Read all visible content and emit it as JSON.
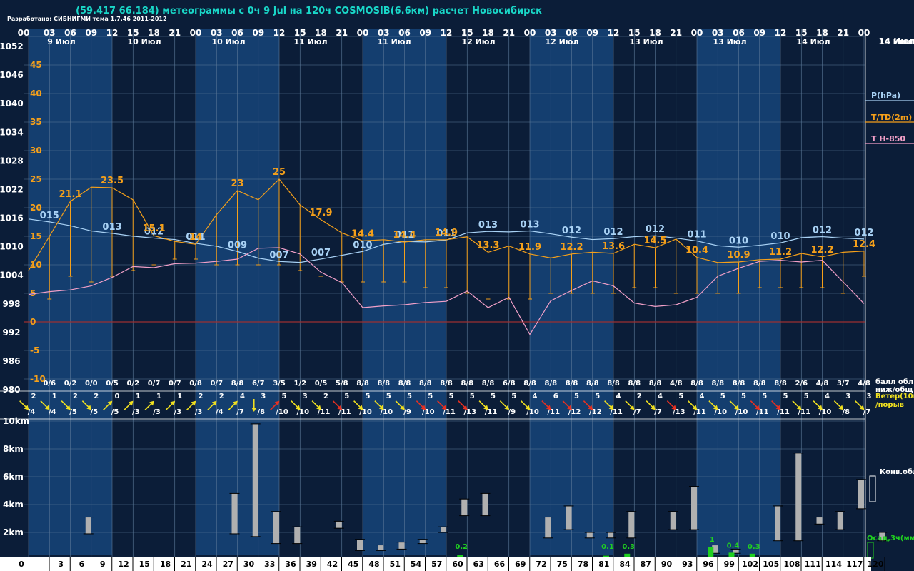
{
  "header": {
    "title": "(59.417 66.184) метеограммы с  0ч 9 Jul на 120ч COSMOSIB(6.6км) расчет Новосибирск",
    "developer": "Разработано: СИБНИГМИ тема 1.7.46 2011-2012"
  },
  "colors": {
    "background": "#0b1d38",
    "band_dark": "#0b1d38",
    "band_light": "#143e6f",
    "grid": "#5d7a99",
    "pressure": "#a9d2f5",
    "temperature": "#f5a01a",
    "t850": "#f2a0c8",
    "wind_normal": "#f0e020",
    "wind_strong": "#e83020",
    "cloud_bars": "#b0b0b0",
    "precip": "#20d020",
    "zero_line": "#9c3030",
    "text": "#ffffff"
  },
  "chart_data": {
    "type": "line",
    "top_hour_ticks": [
      "00",
      "03",
      "06",
      "09",
      "12",
      "15",
      "18",
      "21",
      "00",
      "03",
      "06",
      "09",
      "12",
      "15",
      "18",
      "21",
      "00",
      "03",
      "06",
      "09",
      "12",
      "15",
      "18",
      "21",
      "00",
      "03",
      "06",
      "09",
      "12",
      "15",
      "18",
      "21",
      "00",
      "03",
      "06",
      "09",
      "12",
      "15",
      "18",
      "21",
      "00"
    ],
    "date_labels": [
      "9 Июл",
      "10 Июл",
      "10 Июл",
      "11 Июл",
      "11 Июл",
      "12 Июл",
      "12 Июл",
      "13 Июл",
      "13 Июл",
      "14 Июл",
      "14 Июл"
    ],
    "lead_hours": [
      0,
      3,
      6,
      9,
      12,
      15,
      18,
      21,
      24,
      27,
      30,
      33,
      36,
      39,
      42,
      45,
      48,
      51,
      54,
      57,
      60,
      63,
      66,
      69,
      72,
      75,
      78,
      81,
      84,
      87,
      90,
      93,
      96,
      99,
      102,
      105,
      108,
      111,
      114,
      117,
      120
    ],
    "bottom_hour_labels": [
      "0",
      "3",
      "6",
      "9",
      "12",
      "15",
      "18",
      "21",
      "24",
      "27",
      "30",
      "33",
      "36",
      "39",
      "42",
      "45",
      "48",
      "51",
      "54",
      "57",
      "60",
      "63",
      "66",
      "69",
      "72",
      "75",
      "78",
      "81",
      "84",
      "87",
      "90",
      "93",
      "96",
      "99",
      "102",
      "105",
      "108",
      "111",
      "114",
      "117",
      "120"
    ],
    "pressure_axis_labels": [
      "1052",
      "1046",
      "1040",
      "1034",
      "1028",
      "1022",
      "1016",
      "1010",
      "1004",
      "998",
      "992",
      "986",
      "980"
    ],
    "pressure_ylim": [
      980,
      1052
    ],
    "temperature_axis_labels": [
      "45",
      "40",
      "35",
      "30",
      "25",
      "20",
      "15",
      "10",
      "5",
      "0",
      "-5",
      "-10"
    ],
    "temperature_ylim": [
      -10,
      50
    ],
    "series": [
      {
        "name": "P(hPa)",
        "values": [
          1015.8,
          1015.2,
          1014.4,
          1013.3,
          1012.8,
          1012.2,
          1011.8,
          1011.5,
          1010.7,
          1010.1,
          1009.0,
          1007.6,
          1006.9,
          1006.7,
          1007.4,
          1008.2,
          1009.0,
          1010.5,
          1011.1,
          1011.0,
          1011.4,
          1012.9,
          1013.2,
          1013.1,
          1013.3,
          1012.7,
          1012.0,
          1011.5,
          1011.7,
          1012.1,
          1012.3,
          1011.8,
          1011.2,
          1010.2,
          1009.9,
          1010.3,
          1010.8,
          1011.9,
          1012.1,
          1011.8,
          1011.6
        ],
        "labels": [
          {
            "i": 1,
            "t": "015"
          },
          {
            "i": 4,
            "t": "013"
          },
          {
            "i": 6,
            "t": "012"
          },
          {
            "i": 8,
            "t": "011"
          },
          {
            "i": 10,
            "t": "009"
          },
          {
            "i": 12,
            "t": "007"
          },
          {
            "i": 14,
            "t": "007"
          },
          {
            "i": 16,
            "t": "010"
          },
          {
            "i": 18,
            "t": "011"
          },
          {
            "i": 20,
            "t": "011"
          },
          {
            "i": 22,
            "t": "013"
          },
          {
            "i": 24,
            "t": "013"
          },
          {
            "i": 26,
            "t": "012"
          },
          {
            "i": 28,
            "t": "012"
          },
          {
            "i": 30,
            "t": "012"
          },
          {
            "i": 32,
            "t": "011"
          },
          {
            "i": 34,
            "t": "010"
          },
          {
            "i": 36,
            "t": "010"
          },
          {
            "i": 38,
            "t": "012"
          },
          {
            "i": 40,
            "t": "012"
          }
        ]
      },
      {
        "name": "T/TD(2m)",
        "values": [
          9.0,
          15.0,
          21.1,
          23.6,
          23.5,
          21.4,
          15.1,
          14.1,
          13.6,
          18.8,
          23.0,
          21.4,
          25.0,
          20.5,
          17.9,
          15.6,
          14.2,
          14.4,
          14.0,
          14.4,
          14.4,
          14.9,
          12.2,
          13.3,
          11.9,
          11.2,
          11.9,
          12.2,
          12.0,
          13.6,
          13.0,
          14.5,
          11.3,
          10.4,
          10.5,
          10.9,
          11.0,
          12.0,
          11.4,
          12.2,
          12.4
        ],
        "dewpoint": [
          -2,
          4,
          8,
          7,
          8,
          9,
          10,
          11,
          11,
          10,
          10,
          10,
          10,
          9,
          8,
          7,
          7,
          7,
          7,
          6,
          6,
          5,
          4,
          4,
          4,
          5,
          5,
          5,
          5,
          6,
          6,
          5,
          5,
          5,
          5,
          6,
          6,
          6,
          6,
          5,
          8
        ],
        "labels": [
          {
            "i": 2,
            "t": "21.1"
          },
          {
            "i": 4,
            "t": "23.5"
          },
          {
            "i": 6,
            "t": "15.1"
          },
          {
            "i": 8,
            "t": "14"
          },
          {
            "i": 10,
            "t": "23"
          },
          {
            "i": 12,
            "t": "25"
          },
          {
            "i": 14,
            "t": "17.9"
          },
          {
            "i": 16,
            "t": "14.4"
          },
          {
            "i": 18,
            "t": "14.4"
          },
          {
            "i": 20,
            "t": "14.9"
          },
          {
            "i": 22,
            "t": "13.3"
          },
          {
            "i": 24,
            "t": "11.9"
          },
          {
            "i": 26,
            "t": "12.2"
          },
          {
            "i": 28,
            "t": "13.6"
          },
          {
            "i": 30,
            "t": "14.5"
          },
          {
            "i": 32,
            "t": "10.4"
          },
          {
            "i": 34,
            "t": "10.9"
          },
          {
            "i": 36,
            "t": "11.2"
          },
          {
            "i": 38,
            "t": "12.2"
          },
          {
            "i": 40,
            "t": "12.4"
          }
        ]
      },
      {
        "name": "T H-850",
        "values": [
          4.8,
          5.3,
          5.6,
          6.3,
          7.8,
          9.7,
          9.5,
          10.2,
          10.3,
          10.6,
          11.0,
          12.9,
          13.0,
          11.9,
          8.7,
          6.9,
          2.5,
          2.8,
          3.0,
          3.4,
          3.6,
          5.4,
          2.5,
          4.3,
          -2.2,
          3.7,
          5.5,
          7.2,
          6.3,
          3.3,
          2.7,
          3.0,
          4.3,
          8.0,
          9.4,
          10.6,
          10.8,
          10.5,
          10.8,
          7.0,
          3.2
        ]
      }
    ],
    "cloud_cover_label": "балл обл.\nниж/общ",
    "cloud_cover": [
      "",
      "0/6",
      "0/2",
      "0/0",
      "0/5",
      "0/2",
      "0/7",
      "0/7",
      "0/8",
      "0/7",
      "8/8",
      "6/7",
      "3/5",
      "1/2",
      "0/5",
      "5/8",
      "8/8",
      "8/8",
      "8/8",
      "8/8",
      "8/8",
      "8/8",
      "8/8",
      "6/8",
      "8/8",
      "8/8",
      "8/8",
      "8/8",
      "8/8",
      "8/8",
      "8/8",
      "4/8",
      "8/8",
      "8/8",
      "8/8",
      "8/8",
      "8/8",
      "2/6",
      "4/8",
      "3/7",
      "4/8"
    ],
    "wind_label": "Ветер(10м)\n/порыв",
    "wind": [
      {
        "s": "2",
        "g": "/4",
        "dir": "nw",
        "strong": false
      },
      {
        "s": "1",
        "g": "/4",
        "dir": "nw",
        "strong": false
      },
      {
        "s": "2",
        "g": "/5",
        "dir": "nw",
        "strong": false
      },
      {
        "s": "2",
        "g": "/5",
        "dir": "nw",
        "strong": false
      },
      {
        "s": "0",
        "g": "/5",
        "dir": "sw",
        "strong": false
      },
      {
        "s": "1",
        "g": "/3",
        "dir": "sw",
        "strong": false
      },
      {
        "s": "1",
        "g": "/3",
        "dir": "sw",
        "strong": false
      },
      {
        "s": "1",
        "g": "/3",
        "dir": "sw",
        "strong": false
      },
      {
        "s": "2",
        "g": "/3",
        "dir": "sw",
        "strong": false
      },
      {
        "s": "2",
        "g": "/4",
        "dir": "sw",
        "strong": false
      },
      {
        "s": "4",
        "g": "/7",
        "dir": "sw",
        "strong": false
      },
      {
        "s": "3",
        "g": "/8",
        "dir": "s",
        "strong": false
      },
      {
        "s": "5",
        "g": "/10",
        "dir": "sw",
        "strong": true
      },
      {
        "s": "3",
        "g": "/10",
        "dir": "nw",
        "strong": false
      },
      {
        "s": "2",
        "g": "/11",
        "dir": "nw",
        "strong": false
      },
      {
        "s": "5",
        "g": "/11",
        "dir": "nw",
        "strong": true
      },
      {
        "s": "5",
        "g": "/10",
        "dir": "nw",
        "strong": false
      },
      {
        "s": "5",
        "g": "/10",
        "dir": "nw",
        "strong": false
      },
      {
        "s": "5",
        "g": "/9",
        "dir": "nw",
        "strong": false
      },
      {
        "s": "5",
        "g": "/10",
        "dir": "nw",
        "strong": true
      },
      {
        "s": "5",
        "g": "/11",
        "dir": "nw",
        "strong": true
      },
      {
        "s": "5",
        "g": "/13",
        "dir": "nw",
        "strong": true
      },
      {
        "s": "5",
        "g": "/11",
        "dir": "nw",
        "strong": false
      },
      {
        "s": "5",
        "g": "/9",
        "dir": "nw",
        "strong": false
      },
      {
        "s": "4",
        "g": "/10",
        "dir": "nw",
        "strong": false
      },
      {
        "s": "6",
        "g": "/11",
        "dir": "nw",
        "strong": true
      },
      {
        "s": "5",
        "g": "/12",
        "dir": "nw",
        "strong": true
      },
      {
        "s": "5",
        "g": "/12",
        "dir": "nw",
        "strong": true
      },
      {
        "s": "4",
        "g": "/11",
        "dir": "nw",
        "strong": false
      },
      {
        "s": "2",
        "g": "/7",
        "dir": "nw",
        "strong": false
      },
      {
        "s": "4",
        "g": "/7",
        "dir": "nw",
        "strong": false
      },
      {
        "s": "5",
        "g": "/13",
        "dir": "nw",
        "strong": true
      },
      {
        "s": "4",
        "g": "/11",
        "dir": "nw",
        "strong": false
      },
      {
        "s": "5",
        "g": "/10",
        "dir": "nw",
        "strong": false
      },
      {
        "s": "5",
        "g": "/10",
        "dir": "nw",
        "strong": false
      },
      {
        "s": "5",
        "g": "/11",
        "dir": "nw",
        "strong": true
      },
      {
        "s": "5",
        "g": "/11",
        "dir": "nw",
        "strong": true
      },
      {
        "s": "5",
        "g": "/11",
        "dir": "nw",
        "strong": false
      },
      {
        "s": "4",
        "g": "/10",
        "dir": "nw",
        "strong": false
      },
      {
        "s": "3",
        "g": "/8",
        "dir": "nw",
        "strong": false
      },
      {
        "s": "3",
        "g": "/7",
        "dir": "nw",
        "strong": false
      }
    ],
    "height_axis_labels": [
      "10km",
      "8km",
      "6km",
      "4km",
      "2km"
    ],
    "height_ylim_km": [
      0,
      10.5
    ],
    "convective_cloud_label": "Конв.обл.",
    "convective_clouds": [
      {
        "i": 3,
        "b": 1.9,
        "t": 3.1
      },
      {
        "i": 10,
        "b": 1.9,
        "t": 4.8
      },
      {
        "i": 11,
        "b": 1.7,
        "t": 9.8
      },
      {
        "i": 12,
        "b": 1.2,
        "t": 3.5
      },
      {
        "i": 13,
        "b": 1.2,
        "t": 2.4
      },
      {
        "i": 15,
        "b": 2.3,
        "t": 2.8
      },
      {
        "i": 16,
        "b": 0.7,
        "t": 1.5
      },
      {
        "i": 17,
        "b": 0.7,
        "t": 1.1
      },
      {
        "i": 18,
        "b": 0.8,
        "t": 1.3
      },
      {
        "i": 19,
        "b": 1.2,
        "t": 1.5
      },
      {
        "i": 20,
        "b": 2.0,
        "t": 2.4
      },
      {
        "i": 21,
        "b": 3.2,
        "t": 4.4
      },
      {
        "i": 22,
        "b": 3.2,
        "t": 4.8
      },
      {
        "i": 25,
        "b": 1.6,
        "t": 3.1
      },
      {
        "i": 26,
        "b": 2.2,
        "t": 3.9
      },
      {
        "i": 27,
        "b": 1.6,
        "t": 2.0
      },
      {
        "i": 28,
        "b": 1.6,
        "t": 2.0
      },
      {
        "i": 29,
        "b": 1.6,
        "t": 3.5
      },
      {
        "i": 31,
        "b": 2.2,
        "t": 3.5
      },
      {
        "i": 32,
        "b": 2.2,
        "t": 5.3
      },
      {
        "i": 33,
        "b": 0.5,
        "t": 1.1
      },
      {
        "i": 34,
        "b": 0.5,
        "t": 0.8
      },
      {
        "i": 36,
        "b": 1.4,
        "t": 3.9
      },
      {
        "i": 37,
        "b": 1.4,
        "t": 7.7
      },
      {
        "i": 38,
        "b": 2.6,
        "t": 3.1
      },
      {
        "i": 39,
        "b": 2.2,
        "t": 3.5
      },
      {
        "i": 40,
        "b": 3.7,
        "t": 5.8
      },
      {
        "i": 41,
        "b": 1.4,
        "t": 2.0
      }
    ],
    "precip_label": "Осад,3ч(мм)",
    "precipitation": [
      {
        "i": 21,
        "v": "0.2",
        "amt": 0.2
      },
      {
        "i": 28,
        "v": "0.1",
        "amt": 0.1
      },
      {
        "i": 29,
        "v": "0.3",
        "amt": 0.3
      },
      {
        "i": 33,
        "v": "1",
        "amt": 1.0
      },
      {
        "i": 34,
        "v": "0.4",
        "amt": 0.4
      },
      {
        "i": 35,
        "v": "0.3",
        "amt": 0.3
      }
    ],
    "legend_top_right": [
      "14 Июл",
      "P(hPa)",
      "T/TD(2m)",
      "T H-850"
    ]
  }
}
